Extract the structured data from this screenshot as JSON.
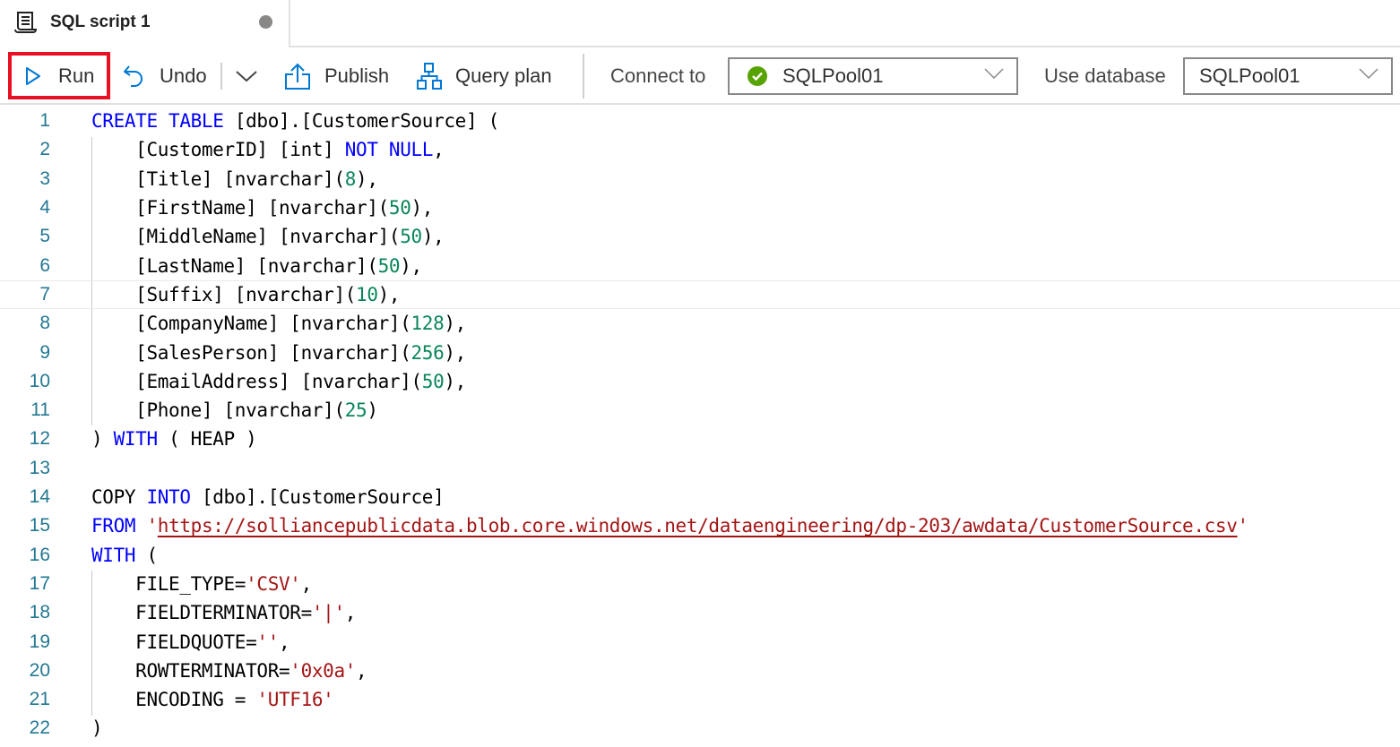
{
  "tab": {
    "title": "SQL script 1",
    "icon": "script-icon",
    "unsaved_indicator": "dot"
  },
  "toolbar": {
    "run_label": "Run",
    "undo_label": "Undo",
    "publish_label": "Publish",
    "query_plan_label": "Query plan",
    "connect_to_label": "Connect to",
    "connect_to_value": "SQLPool01",
    "connect_status": "connected",
    "use_database_label": "Use database",
    "use_database_value": "SQLPool01",
    "highlight_color": "#e81123"
  },
  "editor": {
    "current_line": 7,
    "lines": [
      {
        "n": "1",
        "tokens": [
          [
            "kw",
            "CREATE TABLE"
          ],
          [
            "t",
            " [dbo].[CustomerSource] ("
          ]
        ]
      },
      {
        "n": "2",
        "tokens": [
          [
            "t",
            "    [CustomerID] [int] "
          ],
          [
            "kw",
            "NOT NULL"
          ],
          [
            "t",
            ","
          ]
        ]
      },
      {
        "n": "3",
        "tokens": [
          [
            "t",
            "    [Title] [nvarchar]("
          ],
          [
            "num",
            "8"
          ],
          [
            "t",
            "),"
          ]
        ]
      },
      {
        "n": "4",
        "tokens": [
          [
            "t",
            "    [FirstName] [nvarchar]("
          ],
          [
            "num",
            "50"
          ],
          [
            "t",
            "),"
          ]
        ]
      },
      {
        "n": "5",
        "tokens": [
          [
            "t",
            "    [MiddleName] [nvarchar]("
          ],
          [
            "num",
            "50"
          ],
          [
            "t",
            "),"
          ]
        ]
      },
      {
        "n": "6",
        "tokens": [
          [
            "t",
            "    [LastName] [nvarchar]("
          ],
          [
            "num",
            "50"
          ],
          [
            "t",
            "),"
          ]
        ]
      },
      {
        "n": "7",
        "tokens": [
          [
            "t",
            "    [Suffix] [nvarchar]("
          ],
          [
            "num",
            "10"
          ],
          [
            "t",
            "),"
          ]
        ]
      },
      {
        "n": "8",
        "tokens": [
          [
            "t",
            "    [CompanyName] [nvarchar]("
          ],
          [
            "num",
            "128"
          ],
          [
            "t",
            "),"
          ]
        ]
      },
      {
        "n": "9",
        "tokens": [
          [
            "t",
            "    [SalesPerson] [nvarchar]("
          ],
          [
            "num",
            "256"
          ],
          [
            "t",
            "),"
          ]
        ]
      },
      {
        "n": "10",
        "tokens": [
          [
            "t",
            "    [EmailAddress] [nvarchar]("
          ],
          [
            "num",
            "50"
          ],
          [
            "t",
            "),"
          ]
        ]
      },
      {
        "n": "11",
        "tokens": [
          [
            "t",
            "    [Phone] [nvarchar]("
          ],
          [
            "num",
            "25"
          ],
          [
            "t",
            ")"
          ]
        ]
      },
      {
        "n": "12",
        "tokens": [
          [
            "t",
            ") "
          ],
          [
            "kw",
            "WITH"
          ],
          [
            "t",
            " ( HEAP )"
          ]
        ]
      },
      {
        "n": "13",
        "tokens": []
      },
      {
        "n": "14",
        "tokens": [
          [
            "t",
            "COPY "
          ],
          [
            "kw",
            "INTO"
          ],
          [
            "t",
            " [dbo].[CustomerSource]"
          ]
        ]
      },
      {
        "n": "15",
        "tokens": [
          [
            "kw",
            "FROM"
          ],
          [
            "t",
            " "
          ],
          [
            "str",
            "'"
          ],
          [
            "url",
            "https://solliancepublicdata.blob.core.windows.net/dataengineering/dp-203/awdata/CustomerSource.csv"
          ],
          [
            "str",
            "'"
          ]
        ]
      },
      {
        "n": "16",
        "tokens": [
          [
            "kw",
            "WITH"
          ],
          [
            "t",
            " ("
          ]
        ]
      },
      {
        "n": "17",
        "tokens": [
          [
            "t",
            "    FILE_TYPE="
          ],
          [
            "str",
            "'CSV'"
          ],
          [
            "t",
            ","
          ]
        ]
      },
      {
        "n": "18",
        "tokens": [
          [
            "t",
            "    FIELDTERMINATOR="
          ],
          [
            "str",
            "'|'"
          ],
          [
            "t",
            ","
          ]
        ]
      },
      {
        "n": "19",
        "tokens": [
          [
            "t",
            "    FIELDQUOTE="
          ],
          [
            "str",
            "''"
          ],
          [
            "t",
            ","
          ]
        ]
      },
      {
        "n": "20",
        "tokens": [
          [
            "t",
            "    ROWTERMINATOR="
          ],
          [
            "str",
            "'0x0a'"
          ],
          [
            "t",
            ","
          ]
        ]
      },
      {
        "n": "21",
        "tokens": [
          [
            "t",
            "    ENCODING = "
          ],
          [
            "str",
            "'UTF16'"
          ]
        ]
      },
      {
        "n": "22",
        "tokens": [
          [
            "t",
            ")"
          ]
        ]
      }
    ]
  }
}
